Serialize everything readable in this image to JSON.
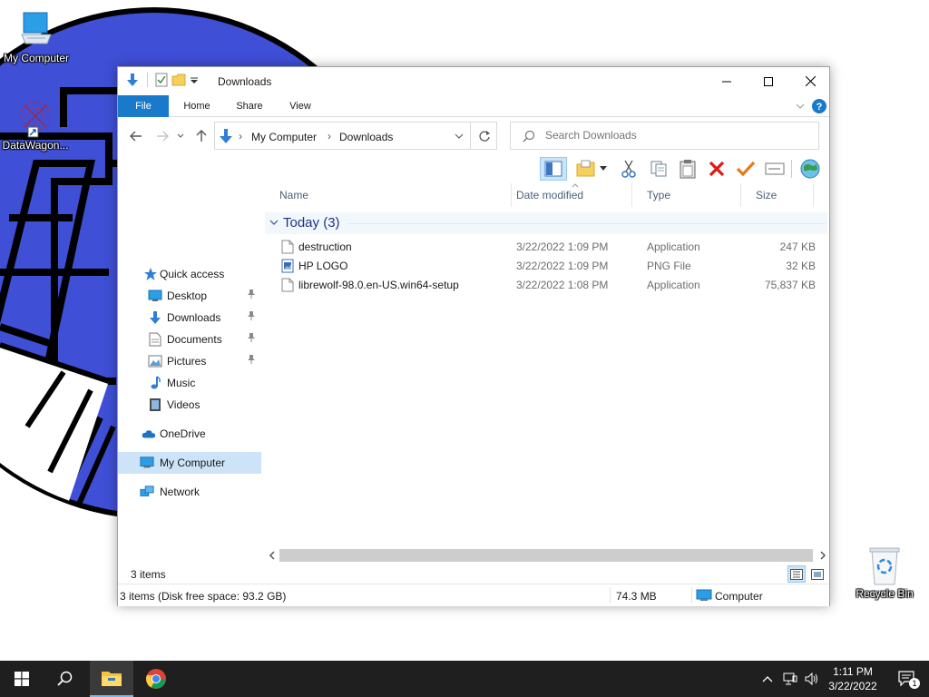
{
  "desktop": {
    "icons": [
      {
        "label": "My Computer",
        "icon": "computer-icon"
      },
      {
        "label": "DataWagon...",
        "icon": "shortcut-icon"
      },
      {
        "label": "Recycle Bin",
        "icon": "recycle-bin-icon"
      }
    ]
  },
  "window": {
    "title": "Downloads",
    "ribbon_tabs": [
      "File",
      "Home",
      "Share",
      "View"
    ],
    "breadcrumb": [
      "My Computer",
      "Downloads"
    ],
    "search_placeholder": "Search Downloads",
    "navigation": [
      {
        "label": "Quick access",
        "icon": "star-icon",
        "pinned": false
      },
      {
        "label": "Desktop",
        "icon": "desktop-icon",
        "pinned": true
      },
      {
        "label": "Downloads",
        "icon": "download-icon",
        "pinned": true
      },
      {
        "label": "Documents",
        "icon": "document-icon",
        "pinned": true
      },
      {
        "label": "Pictures",
        "icon": "pictures-icon",
        "pinned": true
      },
      {
        "label": "Music",
        "icon": "music-icon",
        "pinned": false
      },
      {
        "label": "Videos",
        "icon": "videos-icon",
        "pinned": false
      },
      {
        "label": "OneDrive",
        "icon": "cloud-icon",
        "pinned": false
      },
      {
        "label": "My Computer",
        "icon": "computer-icon",
        "pinned": false,
        "selected": true
      },
      {
        "label": "Network",
        "icon": "network-icon",
        "pinned": false
      }
    ],
    "columns": {
      "name": "Name",
      "date": "Date modified",
      "type": "Type",
      "size": "Size"
    },
    "group": {
      "label": "Today (3)"
    },
    "files": [
      {
        "name": "destruction",
        "date": "3/22/2022 1:09 PM",
        "type": "Application",
        "size": "247 KB",
        "icon": "application-file-icon"
      },
      {
        "name": "HP LOGO",
        "date": "3/22/2022 1:09 PM",
        "type": "PNG File",
        "size": "32 KB",
        "icon": "image-file-icon"
      },
      {
        "name": "librewolf-98.0.en-US.win64-setup",
        "date": "3/22/2022 1:08 PM",
        "type": "Application",
        "size": "75,837 KB",
        "icon": "application-file-icon"
      }
    ],
    "item_count": "3 items",
    "status": {
      "summary": "3 items (Disk free space: 93.2 GB)",
      "size": "74.3 MB",
      "location": "Computer"
    }
  },
  "taskbar": {
    "time": "1:11 PM",
    "date": "3/22/2022",
    "notification_count": "1"
  },
  "colors": {
    "accent": "#1979ca",
    "selection": "#cde3f7",
    "taskbar": "#1f1f1f",
    "wallpaper_disc": "#3f4fd6",
    "group_header": "#1e3287"
  }
}
